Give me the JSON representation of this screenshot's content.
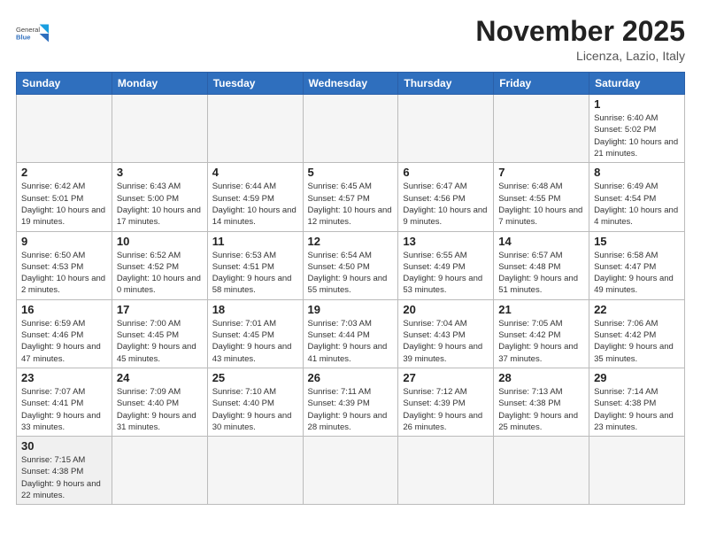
{
  "header": {
    "logo_general": "General",
    "logo_blue": "Blue",
    "month_title": "November 2025",
    "subtitle": "Licenza, Lazio, Italy"
  },
  "days_of_week": [
    "Sunday",
    "Monday",
    "Tuesday",
    "Wednesday",
    "Thursday",
    "Friday",
    "Saturday"
  ],
  "weeks": [
    [
      {
        "day": "",
        "info": ""
      },
      {
        "day": "",
        "info": ""
      },
      {
        "day": "",
        "info": ""
      },
      {
        "day": "",
        "info": ""
      },
      {
        "day": "",
        "info": ""
      },
      {
        "day": "",
        "info": ""
      },
      {
        "day": "1",
        "info": "Sunrise: 6:40 AM\nSunset: 5:02 PM\nDaylight: 10 hours and 21 minutes."
      }
    ],
    [
      {
        "day": "2",
        "info": "Sunrise: 6:42 AM\nSunset: 5:01 PM\nDaylight: 10 hours and 19 minutes."
      },
      {
        "day": "3",
        "info": "Sunrise: 6:43 AM\nSunset: 5:00 PM\nDaylight: 10 hours and 17 minutes."
      },
      {
        "day": "4",
        "info": "Sunrise: 6:44 AM\nSunset: 4:59 PM\nDaylight: 10 hours and 14 minutes."
      },
      {
        "day": "5",
        "info": "Sunrise: 6:45 AM\nSunset: 4:57 PM\nDaylight: 10 hours and 12 minutes."
      },
      {
        "day": "6",
        "info": "Sunrise: 6:47 AM\nSunset: 4:56 PM\nDaylight: 10 hours and 9 minutes."
      },
      {
        "day": "7",
        "info": "Sunrise: 6:48 AM\nSunset: 4:55 PM\nDaylight: 10 hours and 7 minutes."
      },
      {
        "day": "8",
        "info": "Sunrise: 6:49 AM\nSunset: 4:54 PM\nDaylight: 10 hours and 4 minutes."
      }
    ],
    [
      {
        "day": "9",
        "info": "Sunrise: 6:50 AM\nSunset: 4:53 PM\nDaylight: 10 hours and 2 minutes."
      },
      {
        "day": "10",
        "info": "Sunrise: 6:52 AM\nSunset: 4:52 PM\nDaylight: 10 hours and 0 minutes."
      },
      {
        "day": "11",
        "info": "Sunrise: 6:53 AM\nSunset: 4:51 PM\nDaylight: 9 hours and 58 minutes."
      },
      {
        "day": "12",
        "info": "Sunrise: 6:54 AM\nSunset: 4:50 PM\nDaylight: 9 hours and 55 minutes."
      },
      {
        "day": "13",
        "info": "Sunrise: 6:55 AM\nSunset: 4:49 PM\nDaylight: 9 hours and 53 minutes."
      },
      {
        "day": "14",
        "info": "Sunrise: 6:57 AM\nSunset: 4:48 PM\nDaylight: 9 hours and 51 minutes."
      },
      {
        "day": "15",
        "info": "Sunrise: 6:58 AM\nSunset: 4:47 PM\nDaylight: 9 hours and 49 minutes."
      }
    ],
    [
      {
        "day": "16",
        "info": "Sunrise: 6:59 AM\nSunset: 4:46 PM\nDaylight: 9 hours and 47 minutes."
      },
      {
        "day": "17",
        "info": "Sunrise: 7:00 AM\nSunset: 4:45 PM\nDaylight: 9 hours and 45 minutes."
      },
      {
        "day": "18",
        "info": "Sunrise: 7:01 AM\nSunset: 4:45 PM\nDaylight: 9 hours and 43 minutes."
      },
      {
        "day": "19",
        "info": "Sunrise: 7:03 AM\nSunset: 4:44 PM\nDaylight: 9 hours and 41 minutes."
      },
      {
        "day": "20",
        "info": "Sunrise: 7:04 AM\nSunset: 4:43 PM\nDaylight: 9 hours and 39 minutes."
      },
      {
        "day": "21",
        "info": "Sunrise: 7:05 AM\nSunset: 4:42 PM\nDaylight: 9 hours and 37 minutes."
      },
      {
        "day": "22",
        "info": "Sunrise: 7:06 AM\nSunset: 4:42 PM\nDaylight: 9 hours and 35 minutes."
      }
    ],
    [
      {
        "day": "23",
        "info": "Sunrise: 7:07 AM\nSunset: 4:41 PM\nDaylight: 9 hours and 33 minutes."
      },
      {
        "day": "24",
        "info": "Sunrise: 7:09 AM\nSunset: 4:40 PM\nDaylight: 9 hours and 31 minutes."
      },
      {
        "day": "25",
        "info": "Sunrise: 7:10 AM\nSunset: 4:40 PM\nDaylight: 9 hours and 30 minutes."
      },
      {
        "day": "26",
        "info": "Sunrise: 7:11 AM\nSunset: 4:39 PM\nDaylight: 9 hours and 28 minutes."
      },
      {
        "day": "27",
        "info": "Sunrise: 7:12 AM\nSunset: 4:39 PM\nDaylight: 9 hours and 26 minutes."
      },
      {
        "day": "28",
        "info": "Sunrise: 7:13 AM\nSunset: 4:38 PM\nDaylight: 9 hours and 25 minutes."
      },
      {
        "day": "29",
        "info": "Sunrise: 7:14 AM\nSunset: 4:38 PM\nDaylight: 9 hours and 23 minutes."
      }
    ],
    [
      {
        "day": "30",
        "info": "Sunrise: 7:15 AM\nSunset: 4:38 PM\nDaylight: 9 hours and 22 minutes."
      },
      {
        "day": "",
        "info": ""
      },
      {
        "day": "",
        "info": ""
      },
      {
        "day": "",
        "info": ""
      },
      {
        "day": "",
        "info": ""
      },
      {
        "day": "",
        "info": ""
      },
      {
        "day": "",
        "info": ""
      }
    ]
  ]
}
